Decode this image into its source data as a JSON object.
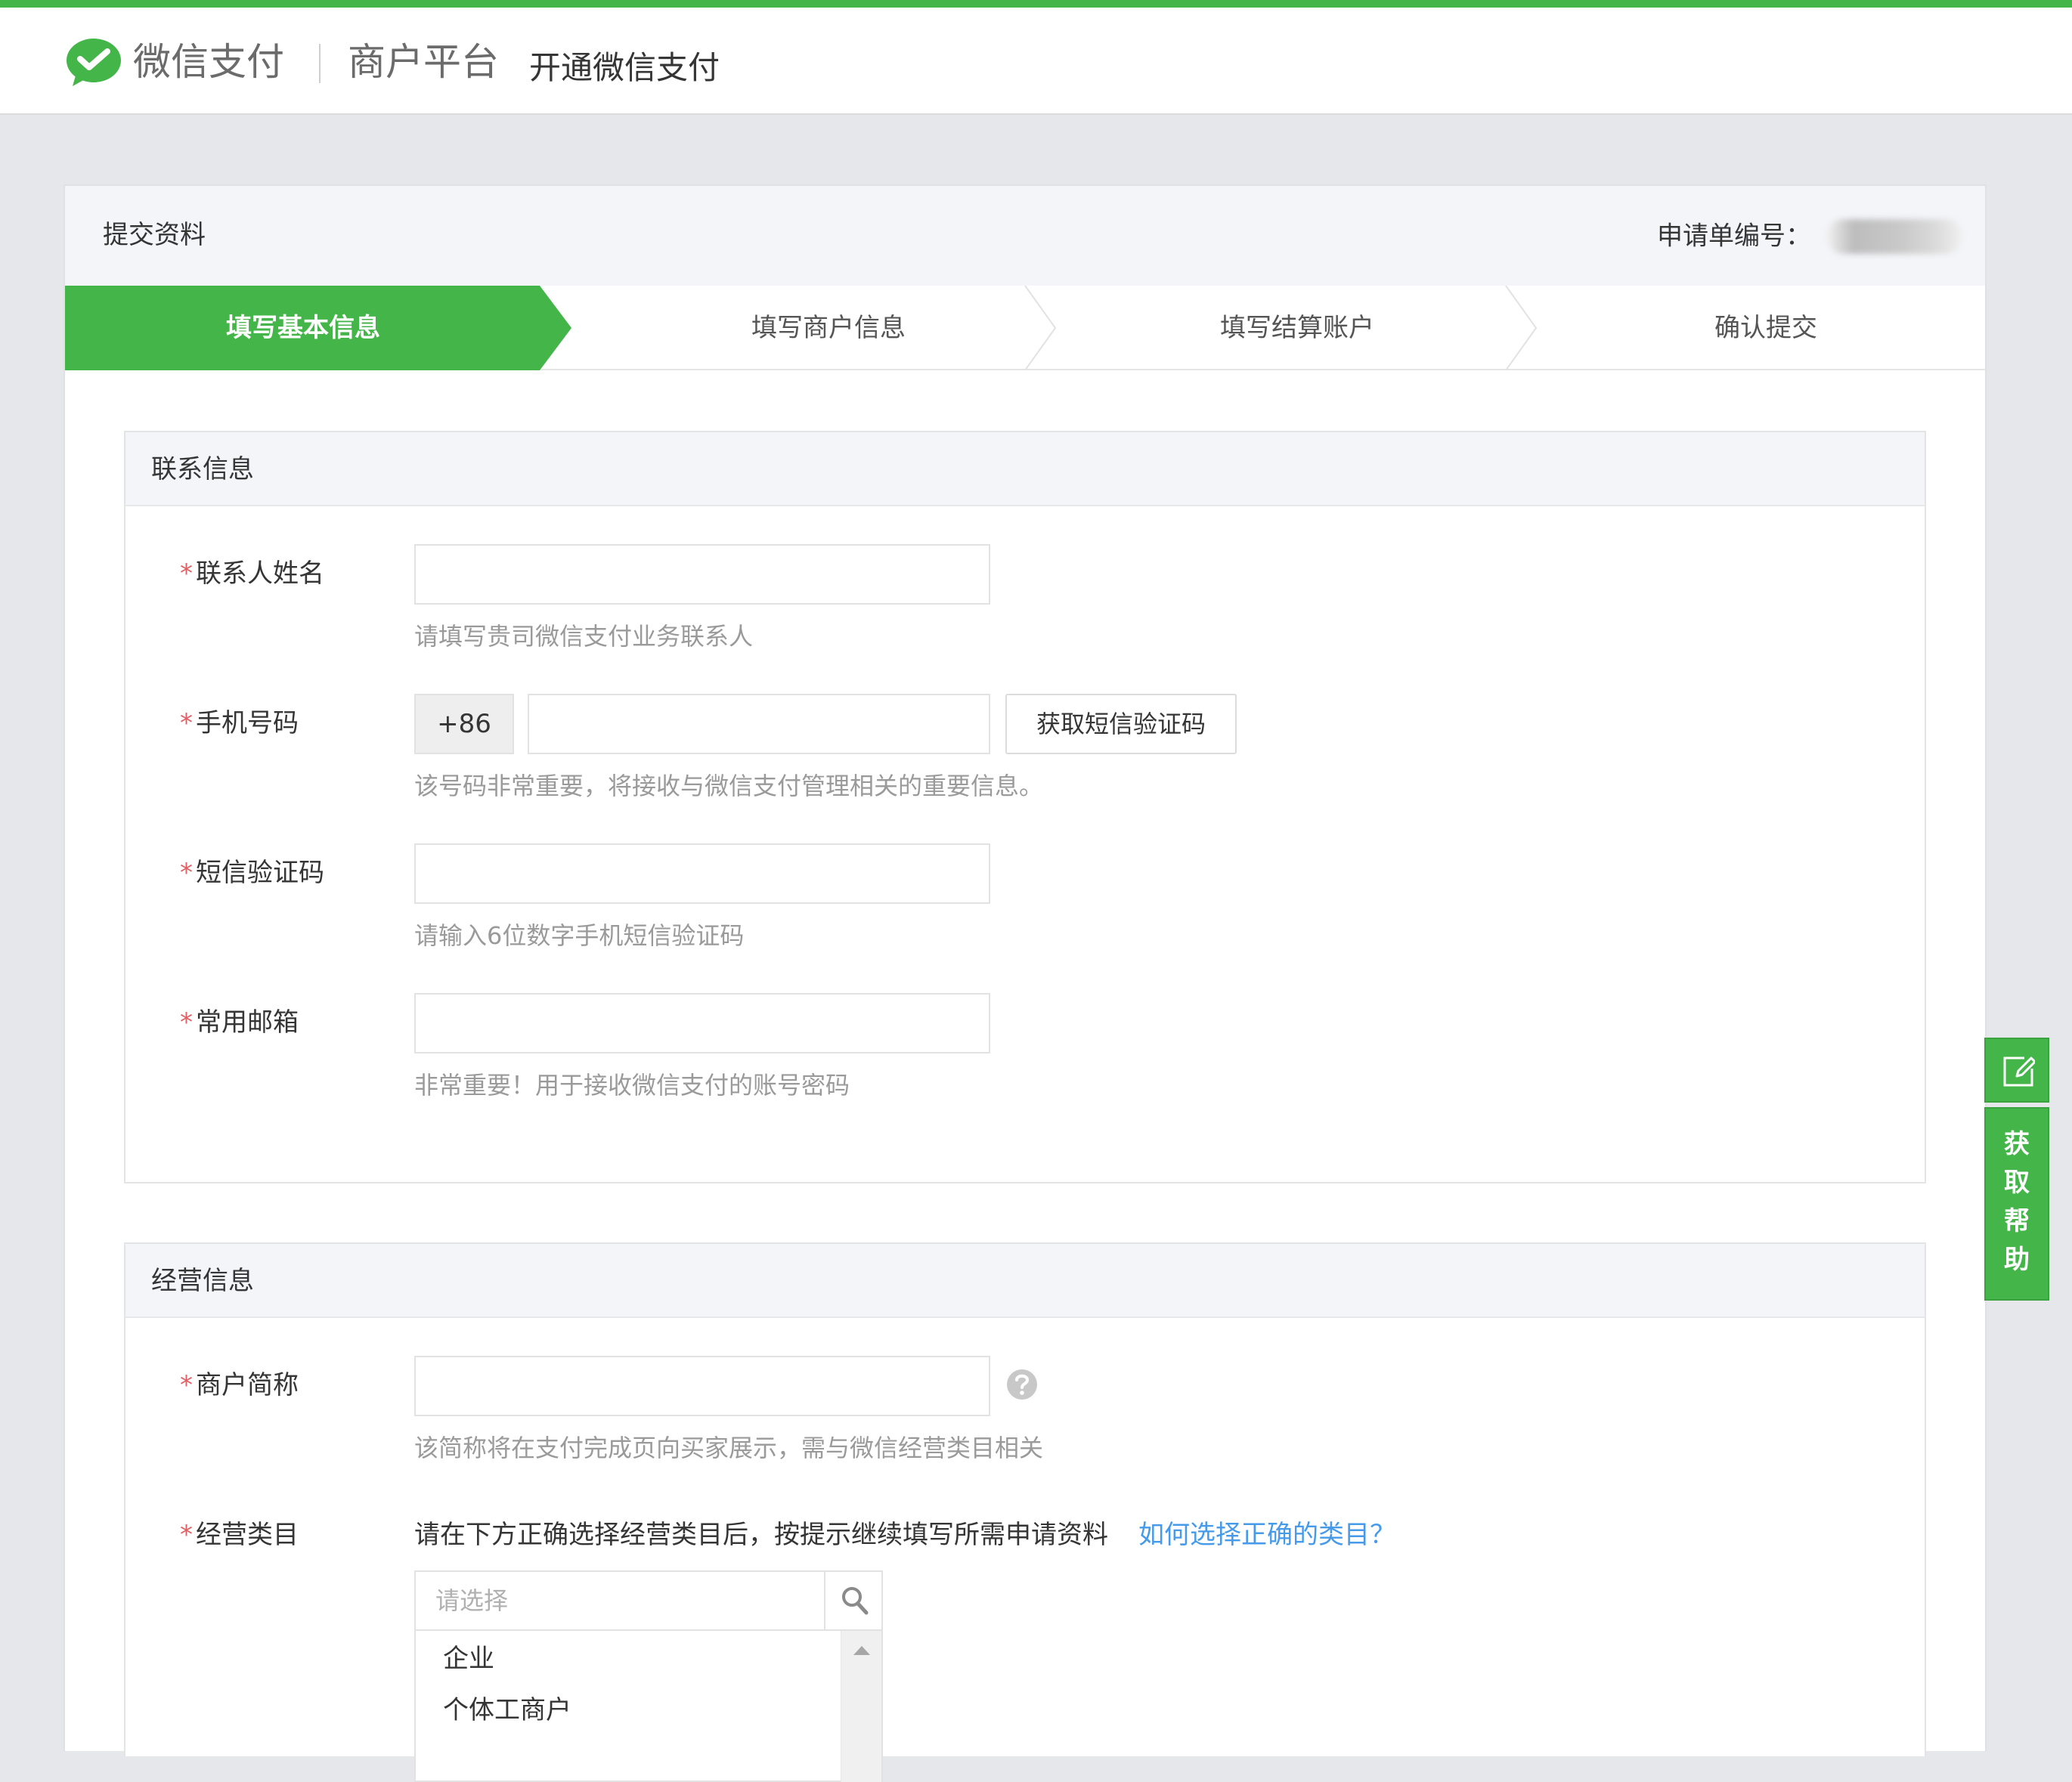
{
  "header": {
    "brand": "微信支付",
    "platform": "商户平台",
    "subtitle": "开通微信支付"
  },
  "card": {
    "title": "提交资料",
    "application_no_label": "申请单编号："
  },
  "steps": [
    {
      "label": "填写基本信息",
      "active": true
    },
    {
      "label": "填写商户信息",
      "active": false
    },
    {
      "label": "填写结算账户",
      "active": false
    },
    {
      "label": "确认提交",
      "active": false
    }
  ],
  "contact": {
    "title": "联系信息",
    "required_mark": "*",
    "name": {
      "label": "联系人姓名",
      "value": "",
      "tip": "请填写贵司微信支付业务联系人"
    },
    "phone": {
      "label": "手机号码",
      "prefix": "+86",
      "value": "",
      "button": "获取短信验证码",
      "tip": "该号码非常重要，将接收与微信支付管理相关的重要信息。"
    },
    "sms_code": {
      "label": "短信验证码",
      "value": "",
      "tip": "请输入6位数字手机短信验证码"
    },
    "email": {
      "label": "常用邮箱",
      "value": "",
      "tip": "非常重要！用于接收微信支付的账号密码"
    }
  },
  "business": {
    "title": "经营信息",
    "required_mark": "*",
    "short_name": {
      "label": "商户简称",
      "value": "",
      "tip": "该简称将在支付完成页向买家展示，需与微信经营类目相关"
    },
    "category": {
      "label": "经营类目",
      "intro": "请在下方正确选择经营类目后，按提示继续填写所需申请资料",
      "link": "如何选择正确的类目？",
      "placeholder": "请选择",
      "options": [
        "企业",
        "个体工商户"
      ]
    }
  },
  "float_help": {
    "label_chars": [
      "获",
      "取",
      "帮",
      "助"
    ]
  },
  "colors": {
    "accent": "#44b549",
    "link": "#459ae9",
    "required": "#e15f63"
  }
}
